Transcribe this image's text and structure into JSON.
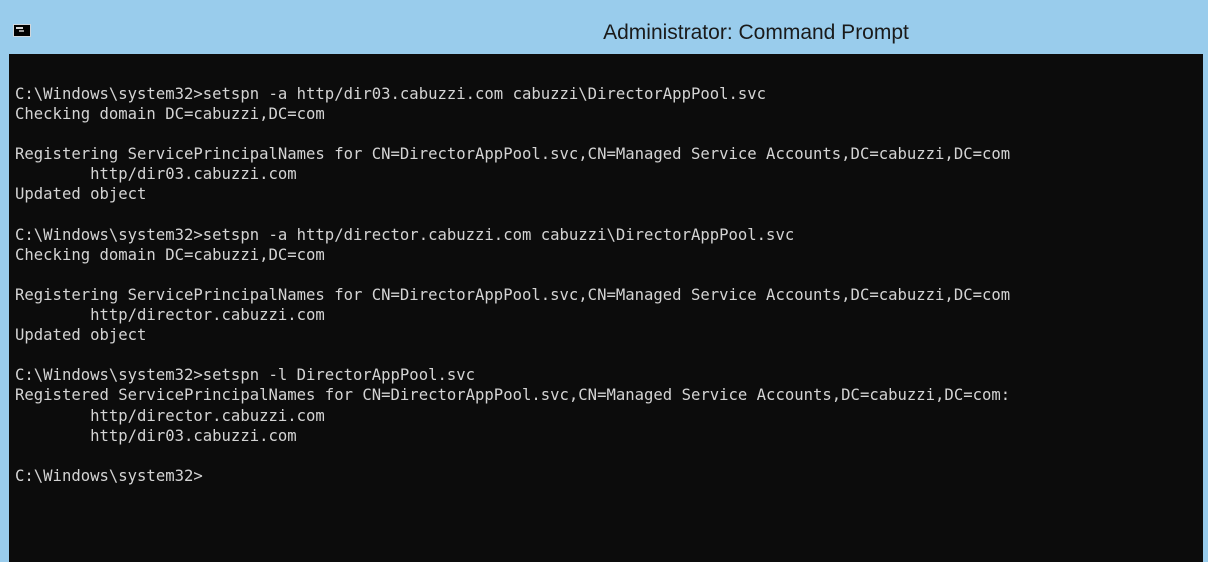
{
  "window": {
    "title": "Administrator: Command Prompt",
    "icon": "cmd-icon",
    "colors": {
      "titlebar": "#99ccec",
      "background": "#0c0c0c",
      "text": "#d4d4d4"
    }
  },
  "console": {
    "lines": [
      "C:\\Windows\\system32>setspn -a http/dir03.cabuzzi.com cabuzzi\\DirectorAppPool.svc",
      "Checking domain DC=cabuzzi,DC=com",
      "",
      "Registering ServicePrincipalNames for CN=DirectorAppPool.svc,CN=Managed Service Accounts,DC=cabuzzi,DC=com",
      "        http/dir03.cabuzzi.com",
      "Updated object",
      "",
      "C:\\Windows\\system32>setspn -a http/director.cabuzzi.com cabuzzi\\DirectorAppPool.svc",
      "Checking domain DC=cabuzzi,DC=com",
      "",
      "Registering ServicePrincipalNames for CN=DirectorAppPool.svc,CN=Managed Service Accounts,DC=cabuzzi,DC=com",
      "        http/director.cabuzzi.com",
      "Updated object",
      "",
      "C:\\Windows\\system32>setspn -l DirectorAppPool.svc",
      "Registered ServicePrincipalNames for CN=DirectorAppPool.svc,CN=Managed Service Accounts,DC=cabuzzi,DC=com:",
      "        http/director.cabuzzi.com",
      "        http/dir03.cabuzzi.com",
      "",
      "C:\\Windows\\system32>"
    ]
  }
}
